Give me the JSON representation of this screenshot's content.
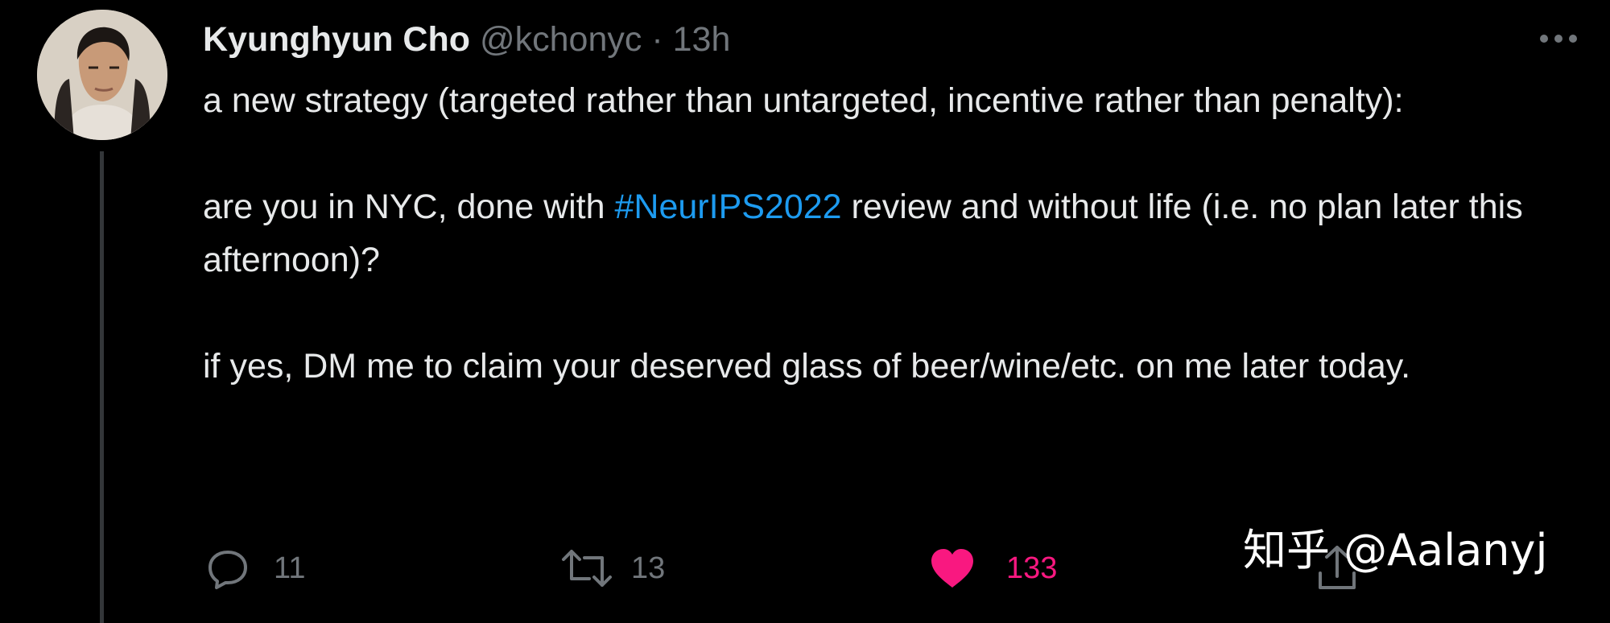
{
  "tweet": {
    "author_name": "Kyunghyun Cho",
    "handle": "@kchonyc",
    "separator": "·",
    "time": "13h",
    "paragraphs": [
      {
        "text": "a new strategy (targeted rather than untargeted, incentive rather than penalty):"
      },
      {
        "before": "are you in NYC, done with ",
        "hashtag": "#NeurIPS2022",
        "after": " review and without life (i.e. no plan later this afternoon)?"
      },
      {
        "text": "if yes, DM me to claim your deserved glass of beer/wine/etc. on me later today."
      }
    ]
  },
  "actions": {
    "reply": {
      "icon": "reply-icon",
      "count": "11"
    },
    "retweet": {
      "icon": "retweet-icon",
      "count": "13"
    },
    "like": {
      "icon": "heart-icon",
      "count": "133",
      "color": "#f91880"
    },
    "share": {
      "icon": "share-icon"
    }
  },
  "watermark": "知乎 @Aalanyj",
  "colors": {
    "background": "#000000",
    "text": "#e7e9ea",
    "muted": "#71767b",
    "link": "#1d9bf0",
    "like": "#f91880",
    "thread_line": "#333639"
  }
}
